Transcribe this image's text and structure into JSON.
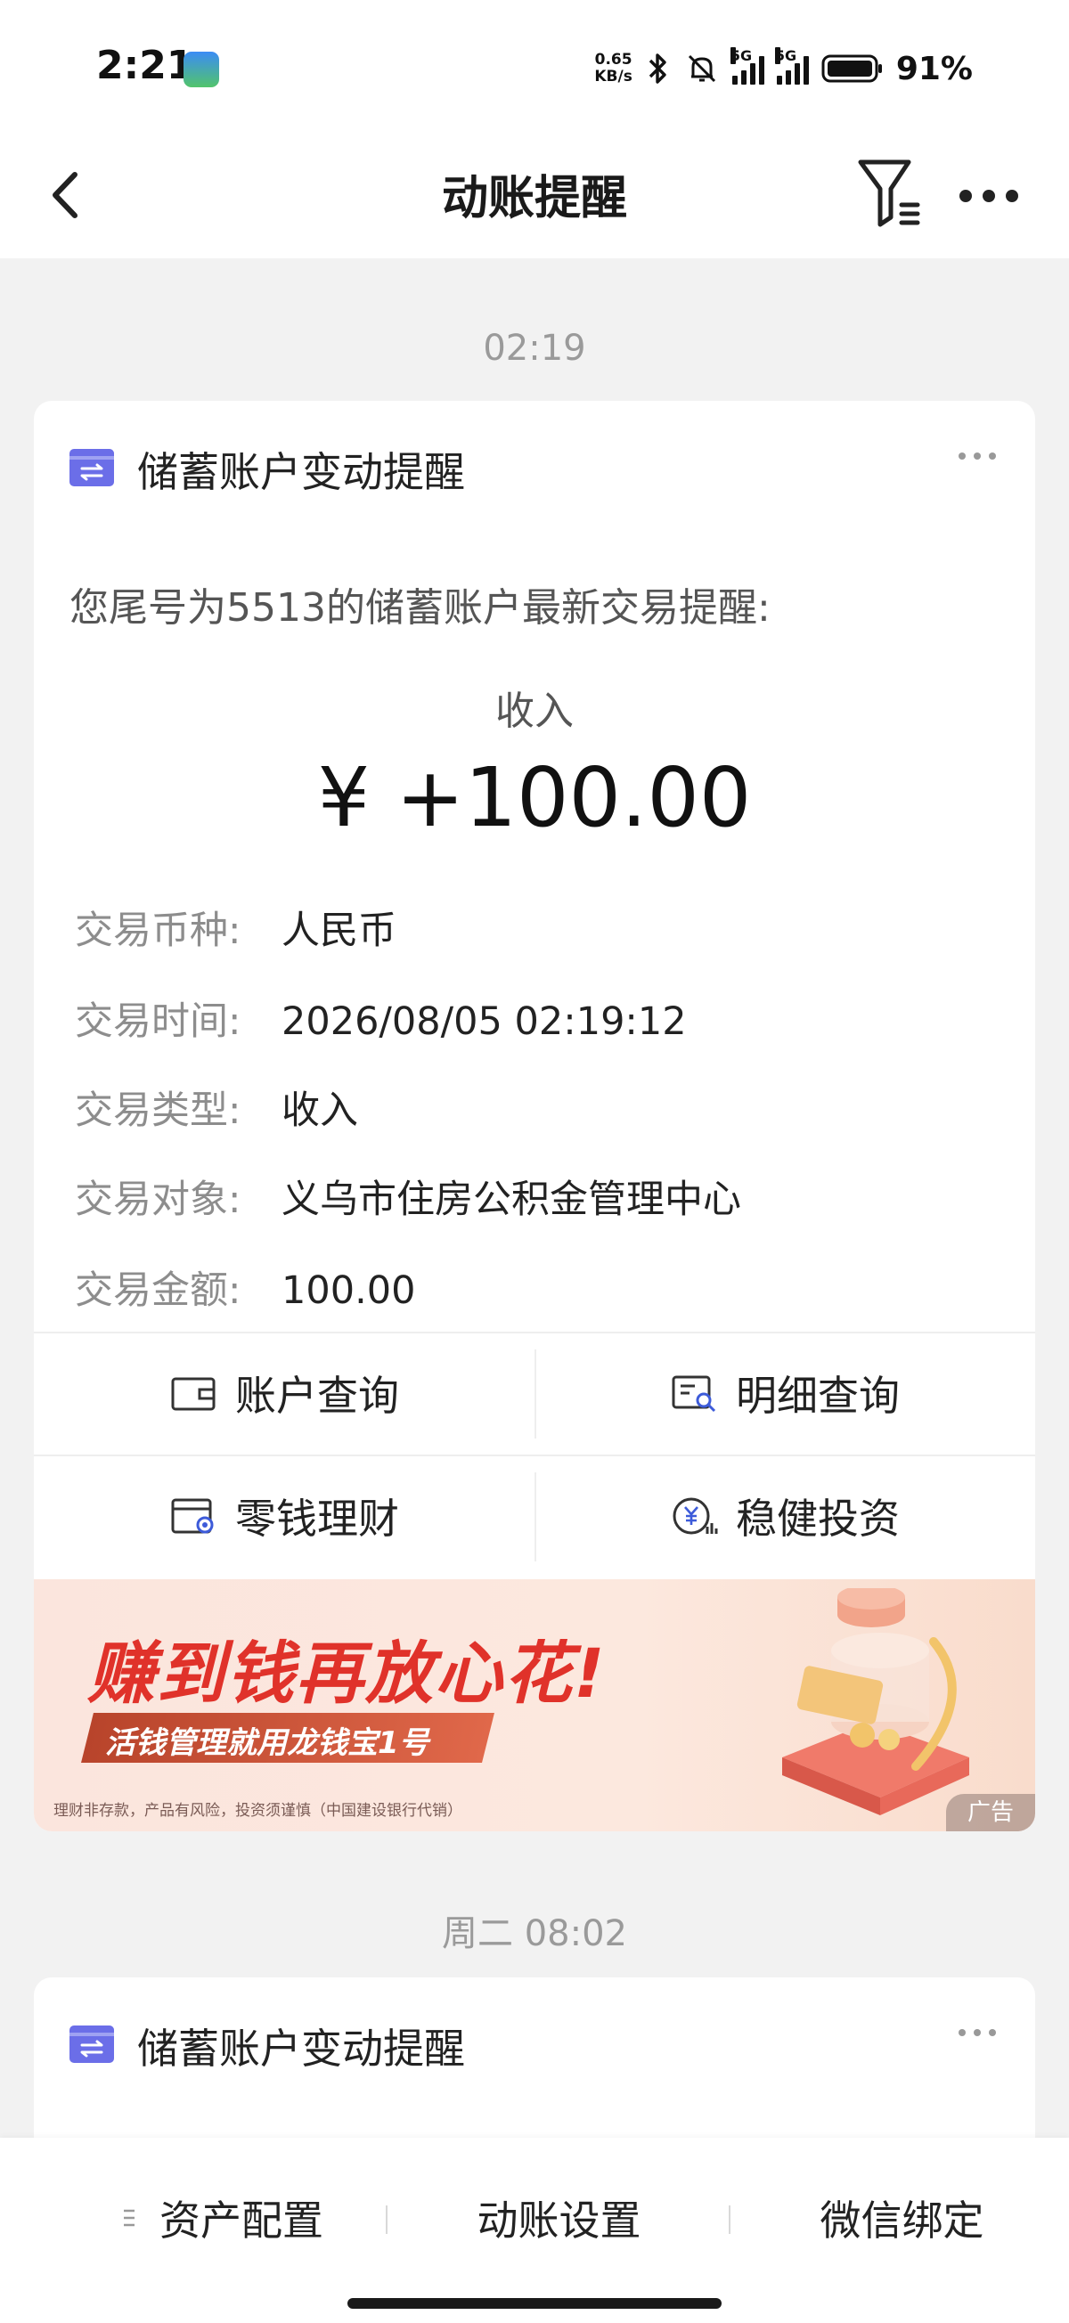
{
  "status_bar": {
    "time": "2:21",
    "speed_value": "0.65",
    "speed_unit": "KB/s",
    "network_1": "5G",
    "network_2": "5G",
    "battery": "91%"
  },
  "nav": {
    "title": "动账提醒",
    "back_icon": "chevron-left-icon",
    "filter_icon": "filter-icon",
    "more_icon": "more-horizontal-icon"
  },
  "feed": [
    {
      "time_label": "02:19",
      "card": {
        "title": "储蓄账户变动提醒",
        "intro": "您尾号为5513的储蓄账户最新交易提醒:",
        "type": "收入",
        "amount": "¥ +100.00",
        "details": [
          {
            "label": "交易币种:",
            "value": "人民币"
          },
          {
            "label": "交易时间:",
            "value": "2026/08/05 02:19:12"
          },
          {
            "label": "交易类型:",
            "value": "收入"
          },
          {
            "label": "交易对象:",
            "value": "义乌市住房公积金管理中心"
          },
          {
            "label": "交易金额:",
            "value": "100.00"
          }
        ],
        "actions": [
          {
            "label": "账户查询",
            "icon": "wallet-icon"
          },
          {
            "label": "明细查询",
            "icon": "detail-search-icon"
          },
          {
            "label": "零钱理财",
            "icon": "wallet-finance-icon"
          },
          {
            "label": "稳健投资",
            "icon": "yuan-investment-icon"
          }
        ]
      },
      "ad": {
        "headline": "赚到钱再放心花!",
        "subline": "活钱管理就用龙钱宝1号",
        "disclaimer": "理财非存款，产品有风险，投资须谨慎（中国建设银行代销）",
        "tag": "广告"
      }
    },
    {
      "time_label": "周二 08:02",
      "card": {
        "title": "储蓄账户变动提醒"
      }
    }
  ],
  "bottom_bar": {
    "items": [
      "资产配置",
      "动账设置",
      "微信绑定"
    ]
  },
  "colors": {
    "accent_purple": "#6b6ee8",
    "ad_red": "#e0322a",
    "label_gray": "#8d8d8d"
  }
}
